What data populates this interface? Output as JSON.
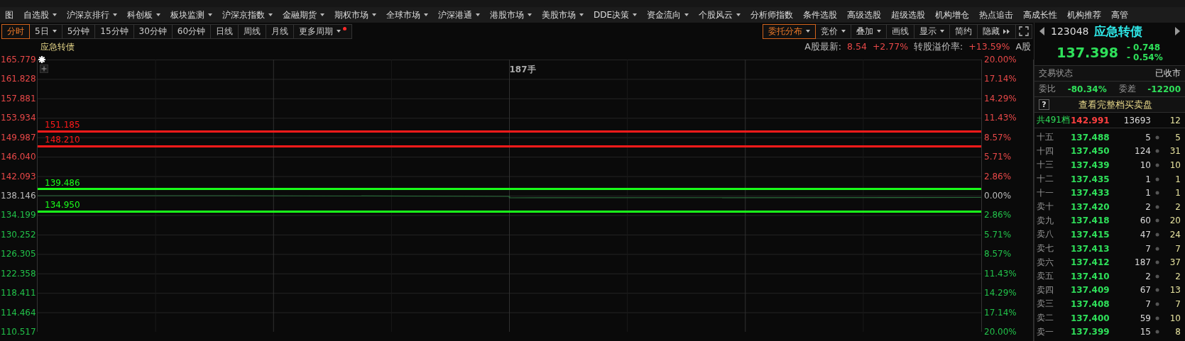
{
  "menu": [
    {
      "label": "图",
      "dropdown": false
    },
    {
      "label": "自选股",
      "dropdown": true
    },
    {
      "label": "沪深京排行",
      "dropdown": true
    },
    {
      "label": "科创板",
      "dropdown": true
    },
    {
      "label": "板块监测",
      "dropdown": true
    },
    {
      "label": "沪深京指数",
      "dropdown": true
    },
    {
      "label": "金融期货",
      "dropdown": true
    },
    {
      "label": "期权市场",
      "dropdown": true
    },
    {
      "label": "全球市场",
      "dropdown": true
    },
    {
      "label": "沪深港通",
      "dropdown": true
    },
    {
      "label": "港股市场",
      "dropdown": true
    },
    {
      "label": "美股市场",
      "dropdown": true
    },
    {
      "label": "DDE决策",
      "dropdown": true
    },
    {
      "label": "资金流向",
      "dropdown": true
    },
    {
      "label": "个股风云",
      "dropdown": true
    },
    {
      "label": "分析师指数",
      "dropdown": false
    },
    {
      "label": "条件选股",
      "dropdown": false
    },
    {
      "label": "高级选股",
      "dropdown": false
    },
    {
      "label": "超级选股",
      "dropdown": false
    },
    {
      "label": "机构增仓",
      "dropdown": false
    },
    {
      "label": "热点追击",
      "dropdown": false
    },
    {
      "label": "高成长性",
      "dropdown": false
    },
    {
      "label": "机构推荐",
      "dropdown": false
    },
    {
      "label": "高管",
      "dropdown": false
    }
  ],
  "periods": [
    {
      "label": "分时",
      "selected": true,
      "dropdown": false,
      "badge": false
    },
    {
      "label": "5日",
      "selected": false,
      "dropdown": true,
      "badge": false
    },
    {
      "label": "5分钟",
      "selected": false,
      "dropdown": false,
      "badge": false
    },
    {
      "label": "15分钟",
      "selected": false,
      "dropdown": false,
      "badge": false
    },
    {
      "label": "30分钟",
      "selected": false,
      "dropdown": false,
      "badge": false
    },
    {
      "label": "60分钟",
      "selected": false,
      "dropdown": false,
      "badge": false
    },
    {
      "label": "日线",
      "selected": false,
      "dropdown": false,
      "badge": false
    },
    {
      "label": "周线",
      "selected": false,
      "dropdown": false,
      "badge": false
    },
    {
      "label": "月线",
      "selected": false,
      "dropdown": false,
      "badge": false
    },
    {
      "label": "更多周期",
      "selected": false,
      "dropdown": true,
      "badge": true
    }
  ],
  "tools": [
    {
      "label": "委托分布",
      "selected": true,
      "kind": "dropdown"
    },
    {
      "label": "竞价",
      "selected": false,
      "kind": "dropdown"
    },
    {
      "label": "叠加",
      "selected": false,
      "kind": "dropdown"
    },
    {
      "label": "画线",
      "selected": false,
      "kind": "plain"
    },
    {
      "label": "显示",
      "selected": false,
      "kind": "dropdown"
    },
    {
      "label": "简约",
      "selected": false,
      "kind": "plain"
    },
    {
      "label": "隐藏",
      "selected": false,
      "kind": "collapse"
    }
  ],
  "chart": {
    "title": "应急转债",
    "info": [
      {
        "text": "A股最新:",
        "color": "#bbbbbb"
      },
      {
        "text": "8.54",
        "color": "#e84848"
      },
      {
        "text": "+2.77%",
        "color": "#e84848"
      },
      {
        "text": "转股溢价率:",
        "color": "#bbbbbb"
      },
      {
        "text": "+13.59%",
        "color": "#e84848"
      },
      {
        "text": "A股",
        "color": "#bbbbbb"
      }
    ],
    "volume_label": "187手",
    "left_axis": [
      {
        "text": "165.779",
        "color": "#e84848"
      },
      {
        "text": "161.828",
        "color": "#e84848"
      },
      {
        "text": "157.881",
        "color": "#e84848"
      },
      {
        "text": "153.934",
        "color": "#e84848"
      },
      {
        "text": "149.987",
        "color": "#e84848"
      },
      {
        "text": "146.040",
        "color": "#e84848"
      },
      {
        "text": "142.093",
        "color": "#e84848"
      },
      {
        "text": "138.146",
        "color": "#bbbbbb"
      },
      {
        "text": "134.199",
        "color": "#22c24a"
      },
      {
        "text": "130.252",
        "color": "#22c24a"
      },
      {
        "text": "126.305",
        "color": "#22c24a"
      },
      {
        "text": "122.358",
        "color": "#22c24a"
      },
      {
        "text": "118.411",
        "color": "#22c24a"
      },
      {
        "text": "114.464",
        "color": "#22c24a"
      },
      {
        "text": "110.517",
        "color": "#22c24a"
      }
    ],
    "right_axis": [
      {
        "text": "20.00%",
        "color": "#e84848"
      },
      {
        "text": "17.14%",
        "color": "#e84848"
      },
      {
        "text": "14.29%",
        "color": "#e84848"
      },
      {
        "text": "11.43%",
        "color": "#e84848"
      },
      {
        "text": "8.57%",
        "color": "#e84848"
      },
      {
        "text": "5.71%",
        "color": "#e84848"
      },
      {
        "text": "2.86%",
        "color": "#e84848"
      },
      {
        "text": "0.00%",
        "color": "#bbbbbb"
      },
      {
        "text": "2.86%",
        "color": "#22c24a"
      },
      {
        "text": "5.71%",
        "color": "#22c24a"
      },
      {
        "text": "8.57%",
        "color": "#22c24a"
      },
      {
        "text": "11.43%",
        "color": "#22c24a"
      },
      {
        "text": "14.29%",
        "color": "#22c24a"
      },
      {
        "text": "17.14%",
        "color": "#22c24a"
      },
      {
        "text": "20.00%",
        "color": "#22c24a"
      }
    ],
    "levels": [
      {
        "label": "151.185",
        "color": "#ff1a1a"
      },
      {
        "label": "148.210",
        "color": "#ff1a1a"
      },
      {
        "label": "139.486",
        "color": "#1aff1a"
      },
      {
        "label": "134.950",
        "color": "#1aff1a"
      }
    ]
  },
  "quote": {
    "code": "123048",
    "name": "应急转债",
    "price": "137.398",
    "change": "- 0.748",
    "change_pct": "- 0.54%",
    "status_label": "交易状态",
    "status": "已收市",
    "ratio_label": "委比",
    "ratio": "-80.34%",
    "diff_label": "委差",
    "diff": "-12200",
    "help": "?",
    "full_book": "查看完整档买卖盘",
    "summary": {
      "label": "共491档",
      "price": "142.991",
      "volume": "13693",
      "count": "12"
    },
    "asks": [
      {
        "label": "十五",
        "price": "137.488",
        "volume": "5",
        "count": "5"
      },
      {
        "label": "十四",
        "price": "137.450",
        "volume": "124",
        "count": "31"
      },
      {
        "label": "十三",
        "price": "137.439",
        "volume": "10",
        "count": "10"
      },
      {
        "label": "十二",
        "price": "137.435",
        "volume": "1",
        "count": "1"
      },
      {
        "label": "十一",
        "price": "137.433",
        "volume": "1",
        "count": "1"
      },
      {
        "label": "卖十",
        "price": "137.420",
        "volume": "2",
        "count": "2"
      },
      {
        "label": "卖九",
        "price": "137.418",
        "volume": "60",
        "count": "20"
      },
      {
        "label": "卖八",
        "price": "137.415",
        "volume": "47",
        "count": "24"
      },
      {
        "label": "卖七",
        "price": "137.413",
        "volume": "7",
        "count": "7"
      },
      {
        "label": "卖六",
        "price": "137.412",
        "volume": "187",
        "count": "37"
      },
      {
        "label": "卖五",
        "price": "137.410",
        "volume": "2",
        "count": "2"
      },
      {
        "label": "卖四",
        "price": "137.409",
        "volume": "67",
        "count": "13"
      },
      {
        "label": "卖三",
        "price": "137.408",
        "volume": "7",
        "count": "7"
      },
      {
        "label": "卖二",
        "price": "137.400",
        "volume": "59",
        "count": "10"
      },
      {
        "label": "卖一",
        "price": "137.399",
        "volume": "15",
        "count": "8"
      }
    ]
  }
}
